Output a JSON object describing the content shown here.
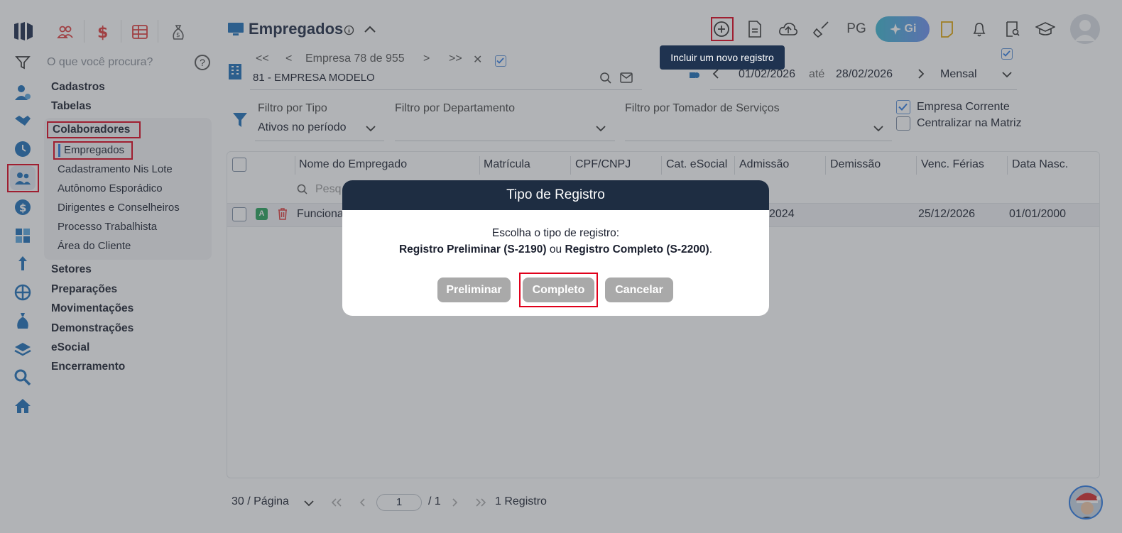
{
  "sidebar": {
    "search_placeholder": "O que você procura?",
    "help": "?",
    "sections": [
      "Cadastros",
      "Tabelas",
      "Colaboradores",
      "Setores",
      "Preparações",
      "Movimentações",
      "Demonstrações",
      "eSocial",
      "Encerramento"
    ],
    "colaboradores_items": [
      "Empregados",
      "Cadastramento Nis Lote",
      "Autônomo Esporádico",
      "Dirigentes e Conselheiros",
      "Processo Trabalhista",
      "Área do Cliente"
    ]
  },
  "header": {
    "title": "Empregados",
    "pg_label": "PG",
    "gi_label": "Gi",
    "tooltip": "Incluir um novo registro"
  },
  "company_nav": {
    "first": "<<",
    "prev": "<",
    "empresa_text": "Empresa 78 de 955",
    "next": ">",
    "last": ">>",
    "close": "✕",
    "company": "81 - EMPRESA MODELO"
  },
  "period": {
    "start": "01/02/2026",
    "ate": "até",
    "end": "28/02/2026",
    "mode": "Mensal"
  },
  "filters": {
    "tipo_label": "Filtro por Tipo",
    "tipo_value": "Ativos no período",
    "depto_label": "Filtro por Departamento",
    "tomador_label": "Filtro por Tomador de Serviços",
    "empresa_corrente": "Empresa Corrente",
    "centralizar": "Centralizar na Matriz"
  },
  "table": {
    "columns": [
      "Nome do Empregado",
      "Matrícula",
      "CPF/CNPJ",
      "Cat. eSocial",
      "Admissão",
      "Demissão",
      "Venc. Férias",
      "Data Nasc."
    ],
    "search_placeholder": "Pesq",
    "rows": [
      {
        "status": "A",
        "nome": "Funciona",
        "admissao": "2024",
        "venc_ferias": "25/12/2026",
        "data_nasc": "01/01/2000"
      }
    ]
  },
  "pager": {
    "per_page": "30 / Página",
    "page": "1",
    "total_pages": "/ 1",
    "records": "1 Registro"
  },
  "modal": {
    "title": "Tipo de Registro",
    "line1": "Escolha o tipo de registro:",
    "opt1": "Registro Preliminar (S-2190)",
    "ou": " ou ",
    "opt2": "Registro Completo (S-2200)",
    "dot": ".",
    "btn_preliminar": "Preliminar",
    "btn_completo": "Completo",
    "btn_cancelar": "Cancelar"
  },
  "colors": {
    "accent_red": "#e0001b",
    "dark_navy": "#1e2d42",
    "rail_blue": "#1d6fb8",
    "button_gray": "#a9a9a9"
  }
}
